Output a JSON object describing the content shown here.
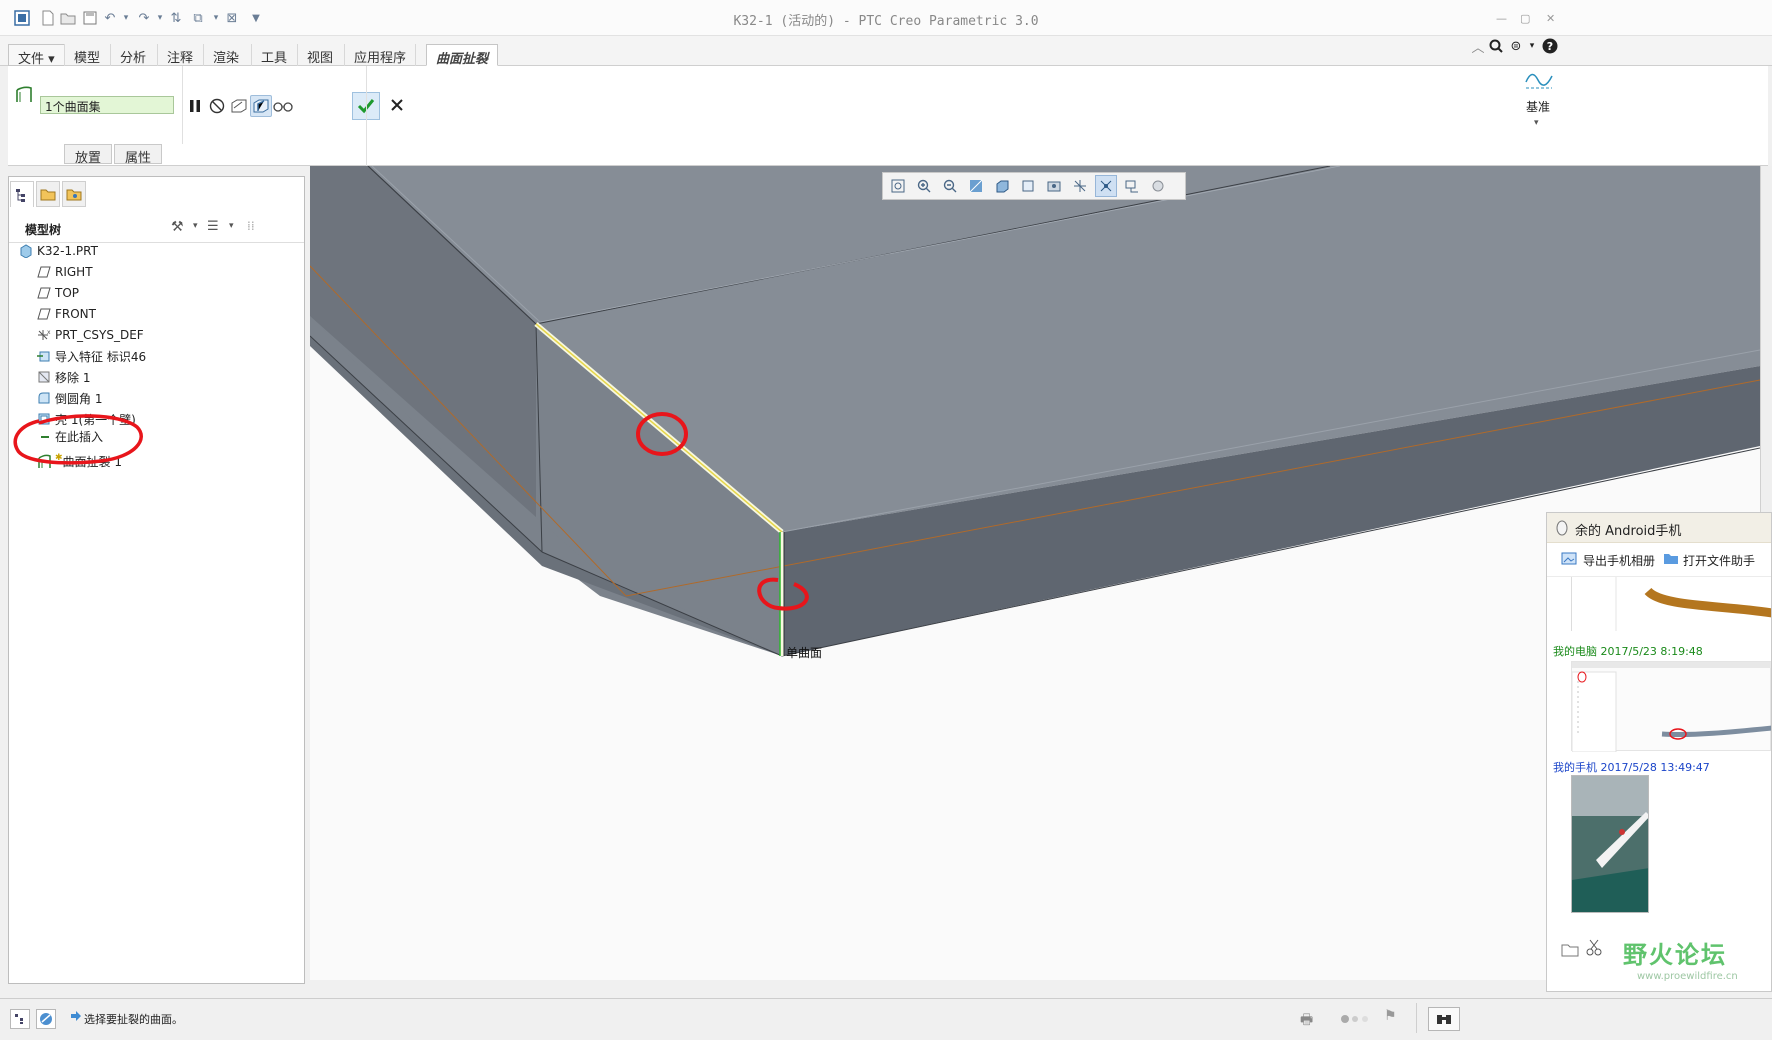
{
  "window": {
    "title": "K32-1 (活动的) - PTC Creo Parametric 3.0"
  },
  "menu": {
    "file": "文件",
    "tabs": [
      "模型",
      "分析",
      "注释",
      "渲染",
      "工具",
      "视图",
      "应用程序",
      "曲面扯裂"
    ]
  },
  "ribbon": {
    "collector_value": "1个曲面集",
    "tab_placement": "放置",
    "tab_properties": "属性",
    "datum_label": "基准"
  },
  "model_tree": {
    "title": "模型树",
    "root": "K32-1.PRT",
    "items": [
      {
        "label": "RIGHT",
        "icon": "datum-plane-icon"
      },
      {
        "label": "TOP",
        "icon": "datum-plane-icon"
      },
      {
        "label": "FRONT",
        "icon": "datum-plane-icon"
      },
      {
        "label": "PRT_CSYS_DEF",
        "icon": "csys-icon"
      },
      {
        "label": "导入特征 标识46",
        "icon": "import-feature-icon"
      },
      {
        "label": "移除 1",
        "icon": "remove-icon"
      },
      {
        "label": "倒圆角 1",
        "icon": "round-icon"
      },
      {
        "label": "壳 1(第一个壁)",
        "icon": "shell-icon"
      },
      {
        "label": "在此插入",
        "icon": "insert-arrow-icon"
      },
      {
        "label": "曲面扯裂 1",
        "icon": "surface-rip-icon"
      }
    ],
    "highlight_color": "#e8151b"
  },
  "viewport": {
    "surface_label": "单曲面"
  },
  "qq_panel": {
    "title": "余的 Android手机",
    "export_album": "导出手机相册",
    "open_folder": "打开文件助手",
    "msg1_sender": "我的电脑 2017/5/23 8:19:48",
    "msg2_sender": "我的手机 2017/5/28 13:49:47",
    "watermark": "野火论坛",
    "watermark_url": "www.proewildfire.cn"
  },
  "statusbar": {
    "message": "选择要扯裂的曲面。"
  },
  "colors": {
    "accent_green": "#1e9a2f",
    "collector_bg": "#e3f6d6",
    "model_gray": "#858c95"
  }
}
